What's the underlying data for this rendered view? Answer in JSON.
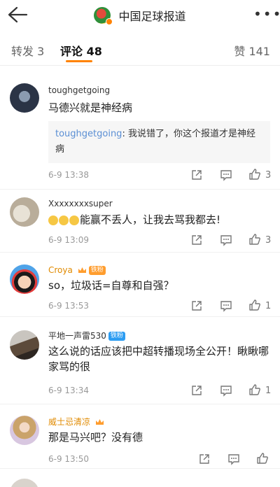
{
  "header": {
    "title": "中国足球报道",
    "back_icon": "back-arrow-icon",
    "more_icon": "more-dots-icon"
  },
  "tabs": [
    {
      "label": "转发 3"
    },
    {
      "label": "评论 48"
    },
    {
      "label": "赞 141"
    }
  ],
  "colors": {
    "accent": "#ff8200",
    "link": "#5b8fd4"
  },
  "comments": [
    {
      "user": "toughgetgoing",
      "text": "马德兴就是神经病",
      "reply": {
        "user": "toughgetgoing",
        "text": ": 我说错了，你这个报道才是神经病"
      },
      "time": "6-9 13:38",
      "likes": "3"
    },
    {
      "user": "Xxxxxxxxsuper",
      "text": "能赢不丢人，让我去骂我都去!",
      "time": "6-9 13:09",
      "likes": "3"
    },
    {
      "user": "Croya",
      "badge": "铁粉",
      "text": "so，垃圾话=自尊和自强？",
      "time": "6-9 13:53",
      "likes": "1"
    },
    {
      "user": "平地一声雷530",
      "badge": "铁粉",
      "text": "这么说的话应该把中超转播现场全公开！瞅瞅哪家骂的很",
      "time": "6-9 13:34",
      "likes": "1"
    },
    {
      "user": "威士忌清凉",
      "text": "那是马兴吧？没有德",
      "time": "6-9 13:50",
      "likes": ""
    }
  ]
}
